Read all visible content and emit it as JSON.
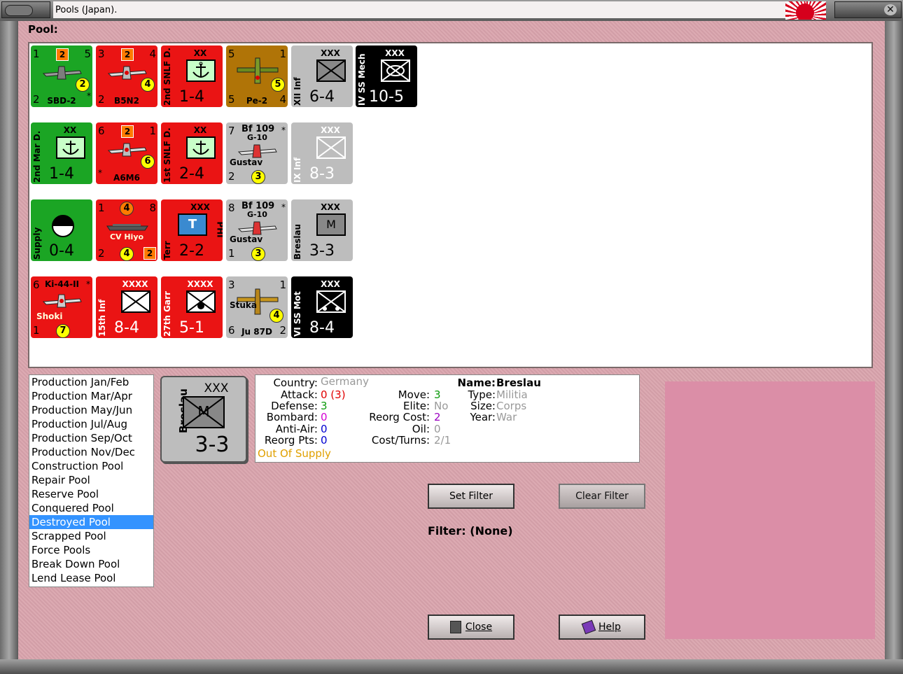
{
  "window": {
    "title": "Pools (Japan)."
  },
  "pool_label": "Pool:",
  "counters": [
    {
      "a": "1",
      "b": "2",
      "c": "5",
      "d": "2",
      "e": "2",
      "name": "SBD-2",
      "star": "*"
    },
    {
      "a": "3",
      "b": "2",
      "c": "4",
      "d": "4",
      "e": "2",
      "name": "B5N2"
    },
    {
      "side": "2nd SNLF D.",
      "size": "XX",
      "big": "1-4"
    },
    {
      "a": "5",
      "c": "1",
      "d": "5",
      "e": "5",
      "f": "4",
      "name": "Pe-2"
    },
    {
      "side": "XII Inf",
      "size": "XXX",
      "big": "6-4"
    },
    {
      "side": "IV SS Mech",
      "size": "XXX",
      "big": "10-5"
    },
    {
      "side": "2nd Mar D.",
      "size": "XX",
      "big": "1-4"
    },
    {
      "a": "6",
      "b": "2",
      "c": "1",
      "d": "6",
      "star": "*",
      "name": "A6M6"
    },
    {
      "side": "1st SNLF D.",
      "size": "XX",
      "big": "2-4"
    },
    {
      "a": "7",
      "top": "Bf 109",
      "sub": "G-10",
      "star": "*",
      "d": "3",
      "e": "2",
      "name": "Gustav"
    },
    {
      "side": "IX Inf",
      "size": "XXX",
      "big": "8-3"
    },
    {
      "side": "Supply",
      "big": "0-4"
    },
    {
      "a": "1",
      "b": "4",
      "c": "8",
      "d": "4",
      "e": "2",
      "f": "2",
      "name": "CV Hiyo"
    },
    {
      "side": "Terr",
      "size": "XXX",
      "right": "PHI",
      "sym": "T",
      "big": "2-2"
    },
    {
      "a": "8",
      "top": "Bf 109",
      "sub": "G-10",
      "star": "*",
      "d": "3",
      "e": "1",
      "name": "Gustav"
    },
    {
      "side": "Breslau",
      "size": "XXX",
      "sym": "M",
      "big": "3-3"
    },
    {
      "a": "6",
      "top": "Ki-44-II",
      "star": "*",
      "d": "7",
      "e": "1",
      "name": "Shoki"
    },
    {
      "side": "15th Inf",
      "size": "XXXX",
      "big": "8-4"
    },
    {
      "side": "27th Garr",
      "size": "XXXX",
      "big": "5-1"
    },
    {
      "a": "3",
      "c": "1",
      "d": "4",
      "e": "6",
      "f": "2",
      "top": "Stuka",
      "name": "Ju 87D"
    },
    {
      "side": "VI SS Mot",
      "size": "XXX",
      "big": "8-4"
    }
  ],
  "pool_list": [
    "Production Jan/Feb",
    "Production Mar/Apr",
    "Production May/Jun",
    "Production Jul/Aug",
    "Production Sep/Oct",
    "Production Nov/Dec",
    "Construction Pool",
    "Repair Pool",
    "Reserve Pool",
    "Conquered Pool",
    "Destroyed Pool",
    "Scrapped Pool",
    "Force Pools",
    "Break Down Pool",
    "Lend Lease Pool"
  ],
  "selected_pool": "Destroyed Pool",
  "selected_unit": {
    "side": "Breslau",
    "size": "XXX",
    "symbol": "M",
    "value": "3-3",
    "country_label": "Country:",
    "country": "Germany",
    "attack_label": "Attack:",
    "attack": "0 (3)",
    "defense_label": "Defense:",
    "defense": "3",
    "bombard_label": "Bombard:",
    "bombard": "0",
    "antiair_label": "Anti-Air:",
    "antiair": "0",
    "reorg_pts_label": "Reorg Pts:",
    "reorg_pts": "0",
    "supply_status": "Out Of Supply",
    "move_label": "Move:",
    "move": "3",
    "elite_label": "Elite:",
    "elite": "No",
    "reorg_cost_label": "Reorg Cost:",
    "reorg_cost": "2",
    "oil_label": "Oil:",
    "oil": "0",
    "cost_turns_label": "Cost/Turns:",
    "cost_turns": "2/1",
    "name_label": "Name:",
    "name": "Breslau",
    "type_label": "Type:",
    "type": "Militia",
    "unit_size_label": "Size:",
    "unit_size": "Corps",
    "year_label": "Year:",
    "year": "War"
  },
  "buttons": {
    "set_filter": "Set Filter",
    "clear_filter": "Clear Filter",
    "close": "Close",
    "help": "Help"
  },
  "filter_text": "Filter: (None)",
  "colors": {
    "green": "#1ba524",
    "red": "#ea1414",
    "gray": "#bdbdbd",
    "black": "#000000",
    "brown": "#b07407",
    "selection": "#3393ff",
    "pink_panel": "#db8ea7"
  }
}
